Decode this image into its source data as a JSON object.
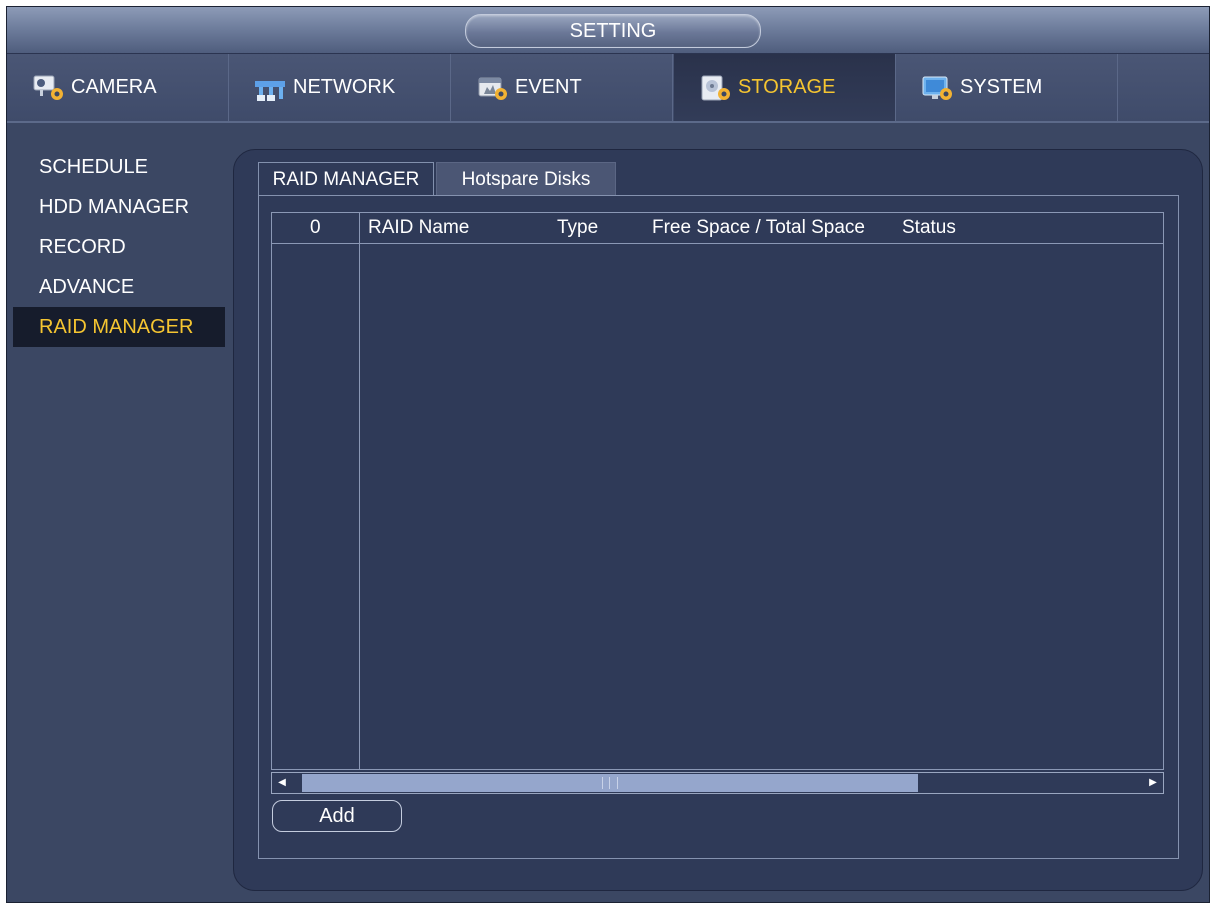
{
  "window": {
    "title": "SETTING"
  },
  "top_tabs": [
    {
      "label": "CAMERA",
      "icon": "camera-settings-icon"
    },
    {
      "label": "NETWORK",
      "icon": "network-settings-icon"
    },
    {
      "label": "EVENT",
      "icon": "event-settings-icon"
    },
    {
      "label": "STORAGE",
      "icon": "storage-settings-icon",
      "active": true
    },
    {
      "label": "SYSTEM",
      "icon": "system-settings-icon"
    }
  ],
  "left_menu": [
    {
      "label": "SCHEDULE"
    },
    {
      "label": "HDD MANAGER"
    },
    {
      "label": "RECORD"
    },
    {
      "label": "ADVANCE"
    },
    {
      "label": "RAID MANAGER",
      "active": true
    }
  ],
  "sub_tabs": [
    {
      "label": "RAID MANAGER",
      "active": true
    },
    {
      "label": "Hotspare Disks"
    }
  ],
  "table": {
    "index_header": "0",
    "headers": [
      "RAID Name",
      "Type",
      "Free Space / Total Space",
      "Status"
    ],
    "rows": []
  },
  "buttons": {
    "add_label": "Add"
  },
  "colors": {
    "accent": "#f5c531",
    "background": "#3b4763",
    "panel": "#2f3a58"
  }
}
